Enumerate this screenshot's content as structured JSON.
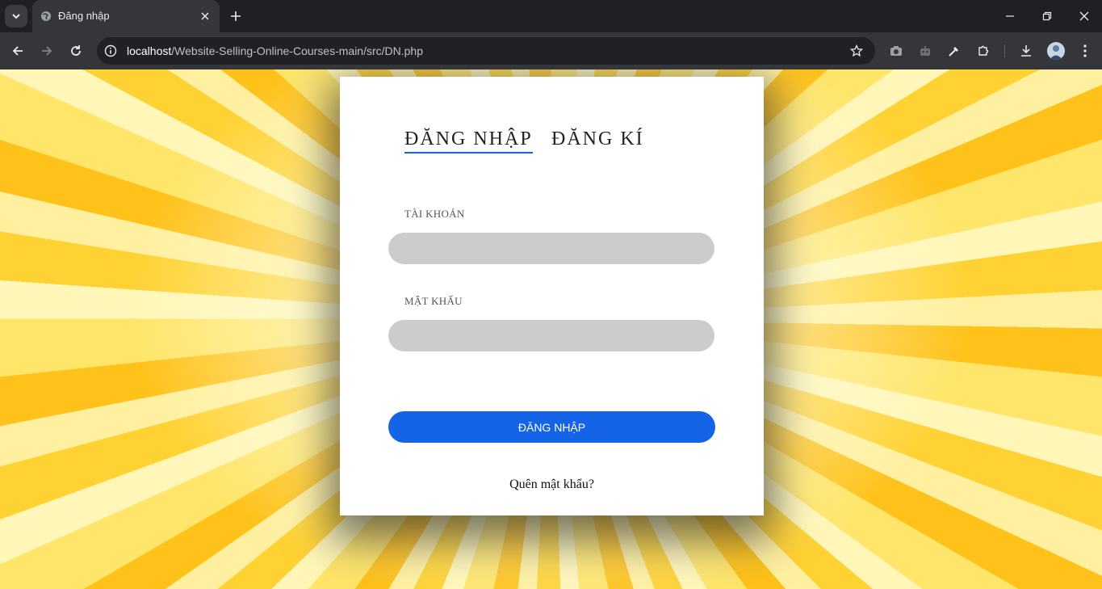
{
  "browser": {
    "tab_title": "Đăng nhập",
    "url_host": "localhost",
    "url_path": "/Website-Selling-Online-Courses-main/src/DN.php"
  },
  "login": {
    "tab_login": "ĐĂNG NHẬP",
    "tab_register": "ĐĂNG KÍ",
    "username_label": "TÀI KHOẢN",
    "password_label": "MẬT KHẨU",
    "username_value": "",
    "password_value": "",
    "submit_label": "ĐĂNG NHẬP",
    "forgot_label": "Quên mật khẩu?"
  },
  "colors": {
    "accent": "#1564e8",
    "input_bg": "#cccccc",
    "background_rays": "#ffd233"
  }
}
